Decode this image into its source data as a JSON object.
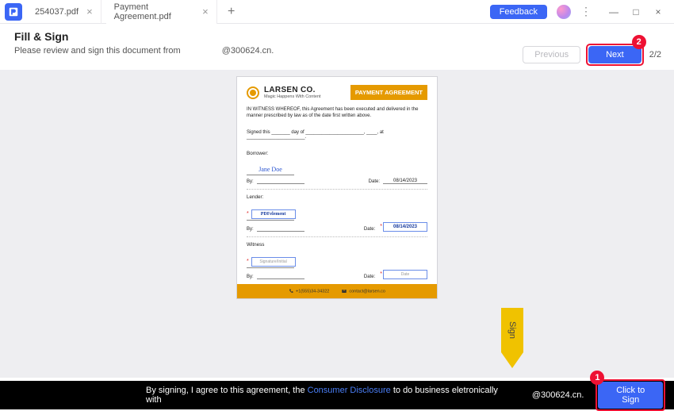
{
  "window": {
    "feedback": "Feedback",
    "minimize": "—",
    "maximize": "□",
    "close": "×"
  },
  "tabs": [
    {
      "label": "254037.pdf",
      "active": false
    },
    {
      "label": "Payment Agreement.pdf",
      "active": true
    }
  ],
  "header": {
    "title": "Fill & Sign",
    "subtitle_prefix": "Please review and sign this document from",
    "subtitle_from": "@300624.cn.",
    "previous": "Previous",
    "next": "Next",
    "page_indicator": "2/2"
  },
  "annotations": {
    "step1": "1",
    "step2": "2",
    "sign_hint": "Sign"
  },
  "document": {
    "company_name": "LARSEN CO.",
    "company_tagline": "Magic Happens With Content",
    "badge": "PAYMENT AGREEMENT",
    "witness_text": "IN WITNESS WHEREOF, this Agreement has been executed and delivered in the manner prescribed by law as of the date first written above.",
    "signed_line": "Signed this _______ day of ______________________, ____, at ______________________.",
    "borrower": {
      "label": "Borrower:",
      "name": "Jane Doe",
      "by": "By:",
      "date_label": "Date:",
      "date_value": "08/14/2023"
    },
    "lender": {
      "label": "Lender:",
      "name": "PDFelement",
      "by": "By:",
      "date_label": "Date:",
      "date_value": "08/14/2023"
    },
    "witness_section": {
      "label": "Witness",
      "name": "Signature/Initial",
      "by": "By:",
      "date_label": "Date:",
      "date_value": "Date"
    },
    "footer": {
      "phone": "+1(555)34-34322",
      "email": "contact@larsen.co"
    }
  },
  "bottom": {
    "agree_prefix": "By signing, I agree to this agreement, the ",
    "consumer_disclosure": "Consumer Disclosure",
    "agree_suffix": " to do business eletronically with",
    "from": "@300624.cn.",
    "click_to_sign": "Click to Sign"
  }
}
